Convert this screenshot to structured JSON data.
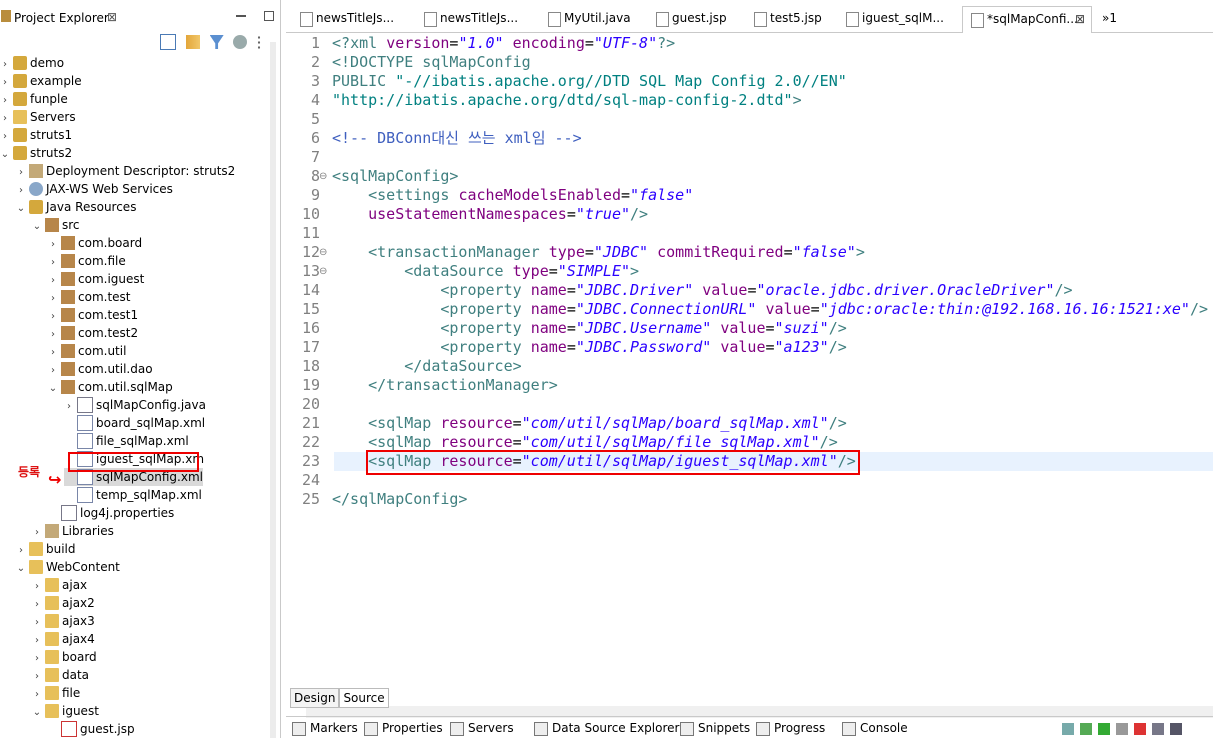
{
  "project_explorer": {
    "title": "Project Explorer",
    "close": "⊠",
    "tree": [
      {
        "label": "demo",
        "indent": 0,
        "twisty": ">",
        "icon": "project-icon"
      },
      {
        "label": "example",
        "indent": 0,
        "twisty": ">",
        "icon": "project-icon"
      },
      {
        "label": "funple",
        "indent": 0,
        "twisty": ">",
        "icon": "project-icon"
      },
      {
        "label": "Servers",
        "indent": 0,
        "twisty": ">",
        "icon": "folder-icon"
      },
      {
        "label": "struts1",
        "indent": 0,
        "twisty": ">",
        "icon": "project-icon"
      },
      {
        "label": "struts2",
        "indent": 0,
        "twisty": "v",
        "icon": "project-icon"
      },
      {
        "label": "Deployment Descriptor: struts2",
        "indent": 1,
        "twisty": ">",
        "icon": "descriptor-icon"
      },
      {
        "label": "JAX-WS Web Services",
        "indent": 1,
        "twisty": ">",
        "icon": "webservice-icon"
      },
      {
        "label": "Java Resources",
        "indent": 1,
        "twisty": "v",
        "icon": "java-resources-icon"
      },
      {
        "label": "src",
        "indent": 2,
        "twisty": "v",
        "icon": "source-folder-icon"
      },
      {
        "label": "com.board",
        "indent": 3,
        "twisty": ">",
        "icon": "package-icon"
      },
      {
        "label": "com.file",
        "indent": 3,
        "twisty": ">",
        "icon": "package-icon"
      },
      {
        "label": "com.iguest",
        "indent": 3,
        "twisty": ">",
        "icon": "package-icon"
      },
      {
        "label": "com.test",
        "indent": 3,
        "twisty": ">",
        "icon": "package-icon"
      },
      {
        "label": "com.test1",
        "indent": 3,
        "twisty": ">",
        "icon": "package-icon"
      },
      {
        "label": "com.test2",
        "indent": 3,
        "twisty": ">",
        "icon": "package-icon"
      },
      {
        "label": "com.util",
        "indent": 3,
        "twisty": ">",
        "icon": "package-icon"
      },
      {
        "label": "com.util.dao",
        "indent": 3,
        "twisty": ">",
        "icon": "package-icon"
      },
      {
        "label": "com.util.sqlMap",
        "indent": 3,
        "twisty": "v",
        "icon": "package-icon"
      },
      {
        "label": "sqlMapConfig.java",
        "indent": 4,
        "twisty": ">",
        "icon": "java-file-icon"
      },
      {
        "label": "board_sqlMap.xml",
        "indent": 4,
        "twisty": "",
        "icon": "xml-file-icon"
      },
      {
        "label": "file_sqlMap.xml",
        "indent": 4,
        "twisty": "",
        "icon": "xml-file-icon"
      },
      {
        "label": "iguest_sqlMap.xm",
        "indent": 4,
        "twisty": "",
        "icon": "xml-file-icon"
      },
      {
        "label": "sqlMapConfig.xml",
        "indent": 4,
        "twisty": "",
        "icon": "xml-file-icon",
        "selected": true
      },
      {
        "label": "temp_sqlMap.xml",
        "indent": 4,
        "twisty": "",
        "icon": "xml-file-icon"
      },
      {
        "label": "log4j.properties",
        "indent": 3,
        "twisty": "",
        "icon": "properties-file-icon"
      },
      {
        "label": "Libraries",
        "indent": 2,
        "twisty": ">",
        "icon": "library-icon"
      },
      {
        "label": "build",
        "indent": 1,
        "twisty": ">",
        "icon": "folder-icon"
      },
      {
        "label": "WebContent",
        "indent": 1,
        "twisty": "v",
        "icon": "folder-icon"
      },
      {
        "label": "ajax",
        "indent": 2,
        "twisty": ">",
        "icon": "folder-icon"
      },
      {
        "label": "ajax2",
        "indent": 2,
        "twisty": ">",
        "icon": "folder-icon"
      },
      {
        "label": "ajax3",
        "indent": 2,
        "twisty": ">",
        "icon": "folder-icon"
      },
      {
        "label": "ajax4",
        "indent": 2,
        "twisty": ">",
        "icon": "folder-icon"
      },
      {
        "label": "board",
        "indent": 2,
        "twisty": ">",
        "icon": "folder-icon"
      },
      {
        "label": "data",
        "indent": 2,
        "twisty": ">",
        "icon": "folder-icon"
      },
      {
        "label": "file",
        "indent": 2,
        "twisty": ">",
        "icon": "folder-icon"
      },
      {
        "label": "iguest",
        "indent": 2,
        "twisty": "v",
        "icon": "folder-icon"
      },
      {
        "label": "guest.jsp",
        "indent": 3,
        "twisty": "",
        "icon": "jsp-file-icon"
      }
    ],
    "annotation": "등록"
  },
  "editor": {
    "tabs": [
      {
        "label": "newsTitleJs...",
        "icon": "file-icon"
      },
      {
        "label": "newsTitleJs...",
        "icon": "file-icon"
      },
      {
        "label": "MyUtil.java",
        "icon": "java-file-icon"
      },
      {
        "label": "guest.jsp",
        "icon": "jsp-file-icon"
      },
      {
        "label": "test5.jsp",
        "icon": "jsp-file-icon"
      },
      {
        "label": "iguest_sqlM...",
        "icon": "xml-file-icon"
      },
      {
        "label": "*sqlMapConfi...",
        "icon": "xml-file-icon",
        "active": true,
        "close": "⊠"
      }
    ],
    "overflow": "»1",
    "lines": [
      {
        "n": "1",
        "parts": [
          [
            "tg",
            "<?"
          ],
          [
            "tg",
            "xml "
          ],
          [
            "at",
            "version"
          ],
          [
            "tx",
            "="
          ],
          [
            "av",
            "\"1.0\""
          ],
          [
            "tx",
            " "
          ],
          [
            "at",
            "encoding"
          ],
          [
            "tx",
            "="
          ],
          [
            "av",
            "\"UTF-8\""
          ],
          [
            "tg",
            "?>"
          ]
        ]
      },
      {
        "n": "2",
        "parts": [
          [
            "tg",
            "<!DOCTYPE sqlMapConfig"
          ]
        ]
      },
      {
        "n": "3",
        "parts": [
          [
            "tg",
            "PUBLIC "
          ],
          [
            "dt",
            "\"-//ibatis.apache.org//DTD SQL Map Config 2.0//EN\""
          ]
        ]
      },
      {
        "n": "4",
        "parts": [
          [
            "dt",
            "\"http://ibatis.apache.org/dtd/sql-map-config-2.dtd\""
          ],
          [
            "tg",
            ">"
          ]
        ]
      },
      {
        "n": "5",
        "parts": []
      },
      {
        "n": "6",
        "parts": [
          [
            "cm",
            "<!-- DBConn대신 쓰는 xml임 -->"
          ]
        ]
      },
      {
        "n": "7",
        "parts": []
      },
      {
        "n": "8",
        "fold": true,
        "parts": [
          [
            "tg",
            "<sqlMapConfig>"
          ]
        ]
      },
      {
        "n": "9",
        "parts": [
          [
            "tx",
            "    "
          ],
          [
            "tg",
            "<settings "
          ],
          [
            "at",
            "cacheModelsEnabled"
          ],
          [
            "tx",
            "="
          ],
          [
            "av",
            "\"false\""
          ]
        ]
      },
      {
        "n": "10",
        "parts": [
          [
            "tx",
            "    "
          ],
          [
            "at",
            "useStatementNamespaces"
          ],
          [
            "tx",
            "="
          ],
          [
            "av",
            "\"true\""
          ],
          [
            "tg",
            "/>"
          ]
        ]
      },
      {
        "n": "11",
        "parts": []
      },
      {
        "n": "12",
        "fold": true,
        "parts": [
          [
            "tx",
            "    "
          ],
          [
            "tg",
            "<transactionManager "
          ],
          [
            "at",
            "type"
          ],
          [
            "tx",
            "="
          ],
          [
            "av",
            "\"JDBC\""
          ],
          [
            "tx",
            " "
          ],
          [
            "at",
            "commitRequired"
          ],
          [
            "tx",
            "="
          ],
          [
            "av",
            "\"false\""
          ],
          [
            "tg",
            ">"
          ]
        ]
      },
      {
        "n": "13",
        "fold": true,
        "parts": [
          [
            "tx",
            "        "
          ],
          [
            "tg",
            "<dataSource "
          ],
          [
            "at",
            "type"
          ],
          [
            "tx",
            "="
          ],
          [
            "av",
            "\"SIMPLE\""
          ],
          [
            "tg",
            ">"
          ]
        ]
      },
      {
        "n": "14",
        "parts": [
          [
            "tx",
            "            "
          ],
          [
            "tg",
            "<property "
          ],
          [
            "at",
            "name"
          ],
          [
            "tx",
            "="
          ],
          [
            "av",
            "\"JDBC.Driver\""
          ],
          [
            "tx",
            " "
          ],
          [
            "at",
            "value"
          ],
          [
            "tx",
            "="
          ],
          [
            "av",
            "\"oracle.jdbc.driver.OracleDriver\""
          ],
          [
            "tg",
            "/>"
          ]
        ]
      },
      {
        "n": "15",
        "parts": [
          [
            "tx",
            "            "
          ],
          [
            "tg",
            "<property "
          ],
          [
            "at",
            "name"
          ],
          [
            "tx",
            "="
          ],
          [
            "av",
            "\"JDBC.ConnectionURL\""
          ],
          [
            "tx",
            " "
          ],
          [
            "at",
            "value"
          ],
          [
            "tx",
            "="
          ],
          [
            "av",
            "\"jdbc:oracle:thin:@192.168.16.16:1521:xe\""
          ],
          [
            "tg",
            "/>"
          ]
        ]
      },
      {
        "n": "16",
        "parts": [
          [
            "tx",
            "            "
          ],
          [
            "tg",
            "<property "
          ],
          [
            "at",
            "name"
          ],
          [
            "tx",
            "="
          ],
          [
            "av",
            "\"JDBC.Username\""
          ],
          [
            "tx",
            " "
          ],
          [
            "at",
            "value"
          ],
          [
            "tx",
            "="
          ],
          [
            "av",
            "\"suzi\""
          ],
          [
            "tg",
            "/>"
          ]
        ]
      },
      {
        "n": "17",
        "parts": [
          [
            "tx",
            "            "
          ],
          [
            "tg",
            "<property "
          ],
          [
            "at",
            "name"
          ],
          [
            "tx",
            "="
          ],
          [
            "av",
            "\"JDBC.Password\""
          ],
          [
            "tx",
            " "
          ],
          [
            "at",
            "value"
          ],
          [
            "tx",
            "="
          ],
          [
            "av",
            "\"a123\""
          ],
          [
            "tg",
            "/>"
          ]
        ]
      },
      {
        "n": "18",
        "parts": [
          [
            "tx",
            "        "
          ],
          [
            "tg",
            "</dataSource>"
          ]
        ]
      },
      {
        "n": "19",
        "parts": [
          [
            "tx",
            "    "
          ],
          [
            "tg",
            "</transactionManager>"
          ]
        ]
      },
      {
        "n": "20",
        "parts": []
      },
      {
        "n": "21",
        "parts": [
          [
            "tx",
            "    "
          ],
          [
            "tg",
            "<sqlMap "
          ],
          [
            "at",
            "resource"
          ],
          [
            "tx",
            "="
          ],
          [
            "av",
            "\"com/util/sqlMap/board_sqlMap.xml\""
          ],
          [
            "tg",
            "/>"
          ]
        ]
      },
      {
        "n": "22",
        "parts": [
          [
            "tx",
            "    "
          ],
          [
            "tg",
            "<sqlMap "
          ],
          [
            "at",
            "resource"
          ],
          [
            "tx",
            "="
          ],
          [
            "av",
            "\"com/util/sqlMap/file_sqlMap.xml\""
          ],
          [
            "tg",
            "/>"
          ]
        ]
      },
      {
        "n": "23",
        "parts": [
          [
            "tx",
            "    "
          ],
          [
            "tg",
            "<sqlMap "
          ],
          [
            "at",
            "resource"
          ],
          [
            "tx",
            "="
          ],
          [
            "av",
            "\"com/util/sqlMap/iguest_sqlMap.xml\""
          ],
          [
            "tg",
            "/>"
          ]
        ]
      },
      {
        "n": "24",
        "parts": []
      },
      {
        "n": "25",
        "parts": [
          [
            "tg",
            "</sqlMapConfig>"
          ]
        ]
      }
    ],
    "design_tab": "Design",
    "source_tab": "Source"
  },
  "bottom_tabs": [
    {
      "label": "Markers",
      "icon": "markers-icon"
    },
    {
      "label": "Properties",
      "icon": "properties-icon"
    },
    {
      "label": "Servers",
      "icon": "servers-icon"
    },
    {
      "label": "Data Source Explorer",
      "icon": "datasource-icon"
    },
    {
      "label": "Snippets",
      "icon": "snippets-icon"
    },
    {
      "label": "Progress",
      "icon": "progress-icon"
    },
    {
      "label": "Console",
      "icon": "console-icon"
    }
  ]
}
